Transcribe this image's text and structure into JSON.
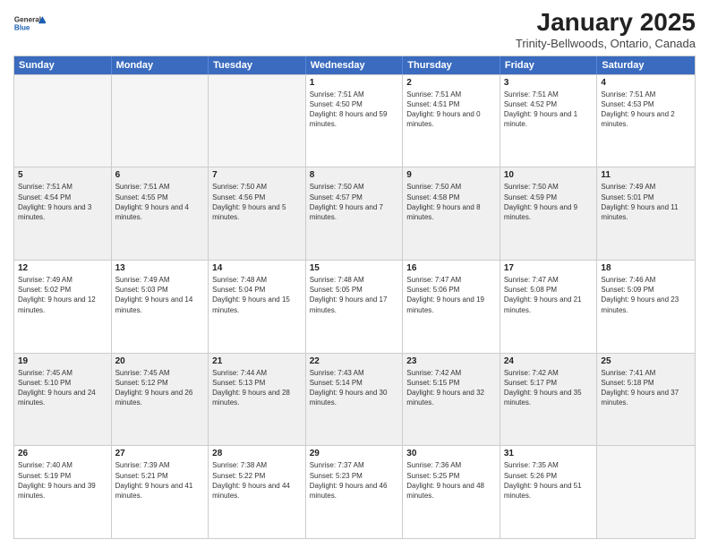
{
  "logo": {
    "general": "General",
    "blue": "Blue"
  },
  "header": {
    "month": "January 2025",
    "location": "Trinity-Bellwoods, Ontario, Canada"
  },
  "days": [
    "Sunday",
    "Monday",
    "Tuesday",
    "Wednesday",
    "Thursday",
    "Friday",
    "Saturday"
  ],
  "weeks": [
    [
      {
        "day": "",
        "sunrise": "",
        "sunset": "",
        "daylight": "",
        "empty": true
      },
      {
        "day": "",
        "sunrise": "",
        "sunset": "",
        "daylight": "",
        "empty": true
      },
      {
        "day": "",
        "sunrise": "",
        "sunset": "",
        "daylight": "",
        "empty": true
      },
      {
        "day": "1",
        "sunrise": "Sunrise: 7:51 AM",
        "sunset": "Sunset: 4:50 PM",
        "daylight": "Daylight: 8 hours and 59 minutes."
      },
      {
        "day": "2",
        "sunrise": "Sunrise: 7:51 AM",
        "sunset": "Sunset: 4:51 PM",
        "daylight": "Daylight: 9 hours and 0 minutes."
      },
      {
        "day": "3",
        "sunrise": "Sunrise: 7:51 AM",
        "sunset": "Sunset: 4:52 PM",
        "daylight": "Daylight: 9 hours and 1 minute."
      },
      {
        "day": "4",
        "sunrise": "Sunrise: 7:51 AM",
        "sunset": "Sunset: 4:53 PM",
        "daylight": "Daylight: 9 hours and 2 minutes."
      }
    ],
    [
      {
        "day": "5",
        "sunrise": "Sunrise: 7:51 AM",
        "sunset": "Sunset: 4:54 PM",
        "daylight": "Daylight: 9 hours and 3 minutes.",
        "shaded": true
      },
      {
        "day": "6",
        "sunrise": "Sunrise: 7:51 AM",
        "sunset": "Sunset: 4:55 PM",
        "daylight": "Daylight: 9 hours and 4 minutes.",
        "shaded": true
      },
      {
        "day": "7",
        "sunrise": "Sunrise: 7:50 AM",
        "sunset": "Sunset: 4:56 PM",
        "daylight": "Daylight: 9 hours and 5 minutes.",
        "shaded": true
      },
      {
        "day": "8",
        "sunrise": "Sunrise: 7:50 AM",
        "sunset": "Sunset: 4:57 PM",
        "daylight": "Daylight: 9 hours and 7 minutes.",
        "shaded": true
      },
      {
        "day": "9",
        "sunrise": "Sunrise: 7:50 AM",
        "sunset": "Sunset: 4:58 PM",
        "daylight": "Daylight: 9 hours and 8 minutes.",
        "shaded": true
      },
      {
        "day": "10",
        "sunrise": "Sunrise: 7:50 AM",
        "sunset": "Sunset: 4:59 PM",
        "daylight": "Daylight: 9 hours and 9 minutes.",
        "shaded": true
      },
      {
        "day": "11",
        "sunrise": "Sunrise: 7:49 AM",
        "sunset": "Sunset: 5:01 PM",
        "daylight": "Daylight: 9 hours and 11 minutes.",
        "shaded": true
      }
    ],
    [
      {
        "day": "12",
        "sunrise": "Sunrise: 7:49 AM",
        "sunset": "Sunset: 5:02 PM",
        "daylight": "Daylight: 9 hours and 12 minutes."
      },
      {
        "day": "13",
        "sunrise": "Sunrise: 7:49 AM",
        "sunset": "Sunset: 5:03 PM",
        "daylight": "Daylight: 9 hours and 14 minutes."
      },
      {
        "day": "14",
        "sunrise": "Sunrise: 7:48 AM",
        "sunset": "Sunset: 5:04 PM",
        "daylight": "Daylight: 9 hours and 15 minutes."
      },
      {
        "day": "15",
        "sunrise": "Sunrise: 7:48 AM",
        "sunset": "Sunset: 5:05 PM",
        "daylight": "Daylight: 9 hours and 17 minutes."
      },
      {
        "day": "16",
        "sunrise": "Sunrise: 7:47 AM",
        "sunset": "Sunset: 5:06 PM",
        "daylight": "Daylight: 9 hours and 19 minutes."
      },
      {
        "day": "17",
        "sunrise": "Sunrise: 7:47 AM",
        "sunset": "Sunset: 5:08 PM",
        "daylight": "Daylight: 9 hours and 21 minutes."
      },
      {
        "day": "18",
        "sunrise": "Sunrise: 7:46 AM",
        "sunset": "Sunset: 5:09 PM",
        "daylight": "Daylight: 9 hours and 23 minutes."
      }
    ],
    [
      {
        "day": "19",
        "sunrise": "Sunrise: 7:45 AM",
        "sunset": "Sunset: 5:10 PM",
        "daylight": "Daylight: 9 hours and 24 minutes.",
        "shaded": true
      },
      {
        "day": "20",
        "sunrise": "Sunrise: 7:45 AM",
        "sunset": "Sunset: 5:12 PM",
        "daylight": "Daylight: 9 hours and 26 minutes.",
        "shaded": true
      },
      {
        "day": "21",
        "sunrise": "Sunrise: 7:44 AM",
        "sunset": "Sunset: 5:13 PM",
        "daylight": "Daylight: 9 hours and 28 minutes.",
        "shaded": true
      },
      {
        "day": "22",
        "sunrise": "Sunrise: 7:43 AM",
        "sunset": "Sunset: 5:14 PM",
        "daylight": "Daylight: 9 hours and 30 minutes.",
        "shaded": true
      },
      {
        "day": "23",
        "sunrise": "Sunrise: 7:42 AM",
        "sunset": "Sunset: 5:15 PM",
        "daylight": "Daylight: 9 hours and 32 minutes.",
        "shaded": true
      },
      {
        "day": "24",
        "sunrise": "Sunrise: 7:42 AM",
        "sunset": "Sunset: 5:17 PM",
        "daylight": "Daylight: 9 hours and 35 minutes.",
        "shaded": true
      },
      {
        "day": "25",
        "sunrise": "Sunrise: 7:41 AM",
        "sunset": "Sunset: 5:18 PM",
        "daylight": "Daylight: 9 hours and 37 minutes.",
        "shaded": true
      }
    ],
    [
      {
        "day": "26",
        "sunrise": "Sunrise: 7:40 AM",
        "sunset": "Sunset: 5:19 PM",
        "daylight": "Daylight: 9 hours and 39 minutes."
      },
      {
        "day": "27",
        "sunrise": "Sunrise: 7:39 AM",
        "sunset": "Sunset: 5:21 PM",
        "daylight": "Daylight: 9 hours and 41 minutes."
      },
      {
        "day": "28",
        "sunrise": "Sunrise: 7:38 AM",
        "sunset": "Sunset: 5:22 PM",
        "daylight": "Daylight: 9 hours and 44 minutes."
      },
      {
        "day": "29",
        "sunrise": "Sunrise: 7:37 AM",
        "sunset": "Sunset: 5:23 PM",
        "daylight": "Daylight: 9 hours and 46 minutes."
      },
      {
        "day": "30",
        "sunrise": "Sunrise: 7:36 AM",
        "sunset": "Sunset: 5:25 PM",
        "daylight": "Daylight: 9 hours and 48 minutes."
      },
      {
        "day": "31",
        "sunrise": "Sunrise: 7:35 AM",
        "sunset": "Sunset: 5:26 PM",
        "daylight": "Daylight: 9 hours and 51 minutes."
      },
      {
        "day": "",
        "sunrise": "",
        "sunset": "",
        "daylight": "",
        "empty": true
      }
    ]
  ]
}
